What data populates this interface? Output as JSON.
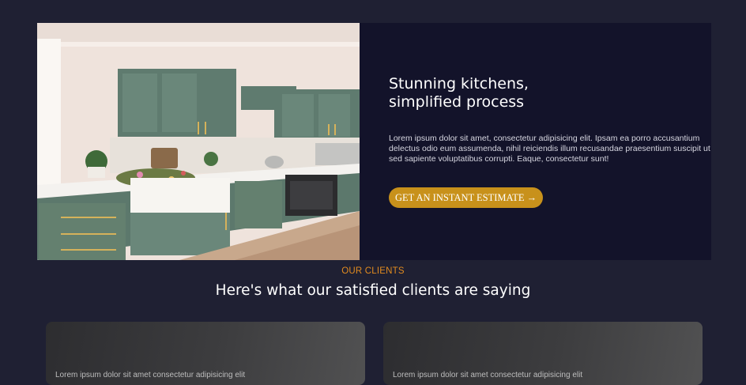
{
  "hero": {
    "title": "Stunning kitchens,\nsimplified process",
    "body": "Lorem ipsum dolor sit amet, consectetur adipisicing elit. Ipsam ea porro accusantium delectus odio eum assumenda, nihil reiciendis illum recusandae praesentium suscipit ut sed sapiente voluptatibus corrupti. Eaque, consectetur sunt!",
    "cta_label": "GET AN INSTANT ESTIMATE →",
    "image_alt": "Kitchen with sage green cabinets"
  },
  "clients": {
    "eyebrow": "OUR CLIENTS",
    "title": "Here's what our satisfied clients are saying",
    "testimonials": [
      {
        "text": "Lorem ipsum dolor sit amet consectetur adipisicing elit"
      },
      {
        "text": "Lorem ipsum dolor sit amet consectetur adipisicing elit"
      }
    ]
  },
  "colors": {
    "page_bg": "#1f2033",
    "hero_bg": "#13132a",
    "accent": "#c8911b",
    "eyebrow": "#e28b1f"
  }
}
